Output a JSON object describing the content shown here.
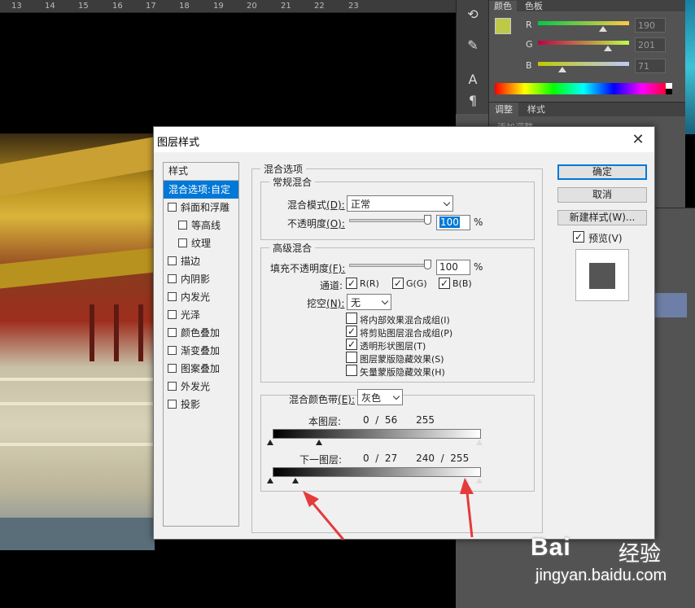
{
  "ruler": {
    "ticks": [
      "13",
      "14",
      "15",
      "16",
      "17",
      "18",
      "19",
      "20",
      "21",
      "22",
      "23"
    ]
  },
  "color_panel": {
    "tabs": [
      "颜色",
      "色板"
    ],
    "channels": [
      {
        "name": "R",
        "value": "190"
      },
      {
        "name": "G",
        "value": "201"
      },
      {
        "name": "B",
        "value": "71"
      }
    ],
    "foreground_color": "#bec947"
  },
  "adjust_panel": {
    "tabs": [
      "调整",
      "样式"
    ],
    "subtitle": "添加调整"
  },
  "dialog": {
    "title": "图层样式",
    "styles_header": "样式",
    "style_items": [
      {
        "label": "混合选项:自定",
        "selected": true,
        "checkbox": false,
        "indent": false
      },
      {
        "label": "斜面和浮雕",
        "selected": false,
        "checkbox": true,
        "indent": false
      },
      {
        "label": "等高线",
        "selected": false,
        "checkbox": true,
        "indent": true
      },
      {
        "label": "纹理",
        "selected": false,
        "checkbox": true,
        "indent": true
      },
      {
        "label": "描边",
        "selected": false,
        "checkbox": true,
        "indent": false
      },
      {
        "label": "内阴影",
        "selected": false,
        "checkbox": true,
        "indent": false
      },
      {
        "label": "内发光",
        "selected": false,
        "checkbox": true,
        "indent": false
      },
      {
        "label": "光泽",
        "selected": false,
        "checkbox": true,
        "indent": false
      },
      {
        "label": "颜色叠加",
        "selected": false,
        "checkbox": true,
        "indent": false
      },
      {
        "label": "渐变叠加",
        "selected": false,
        "checkbox": true,
        "indent": false
      },
      {
        "label": "图案叠加",
        "selected": false,
        "checkbox": true,
        "indent": false
      },
      {
        "label": "外发光",
        "selected": false,
        "checkbox": true,
        "indent": false
      },
      {
        "label": "投影",
        "selected": false,
        "checkbox": true,
        "indent": false
      }
    ],
    "blend_options_title": "混合选项",
    "general_blending": {
      "title": "常规混合",
      "mode_label": "混合模式",
      "mode_key": "(D):",
      "mode_value": "正常",
      "opacity_label": "不透明度",
      "opacity_key": "(O):",
      "opacity_value": "100",
      "percent": "%"
    },
    "advanced_blending": {
      "title": "高级混合",
      "fill_label": "填充不透明度",
      "fill_key": "(F):",
      "fill_value": "100",
      "percent": "%",
      "channels_label": "通道:",
      "channels": [
        {
          "label": "R(R)",
          "checked": true
        },
        {
          "label": "G(G)",
          "checked": true
        },
        {
          "label": "B(B)",
          "checked": true
        }
      ],
      "knockout_label": "挖空",
      "knockout_key": "(N):",
      "knockout_value": "无",
      "options": [
        {
          "label": "将内部效果混合成组(I)",
          "checked": false
        },
        {
          "label": "将剪贴图层混合成组(P)",
          "checked": true
        },
        {
          "label": "透明形状图层(T)",
          "checked": true
        },
        {
          "label": "图层蒙版隐藏效果(S)",
          "checked": false
        },
        {
          "label": "矢量蒙版隐藏效果(H)",
          "checked": false
        }
      ]
    },
    "blend_if": {
      "label": "混合颜色带",
      "key": "(E):",
      "value": "灰色",
      "this_layer_label": "本图层:",
      "this_layer_values": "0  /  56      255",
      "underlying_label": "下一图层:",
      "underlying_values": "0  /  27      240  /  255"
    },
    "buttons": {
      "ok": "确定",
      "cancel": "取消",
      "new_style": "新建样式(W)...",
      "preview": "预览(V)",
      "preview_checked": true
    }
  },
  "watermark": {
    "brand": "Bai",
    "brand_cn": "经验",
    "url": "jingyan.baidu.com"
  },
  "accent_colors": {
    "selection": "#0078d7",
    "annotation_arrow": "#e53a3a"
  }
}
